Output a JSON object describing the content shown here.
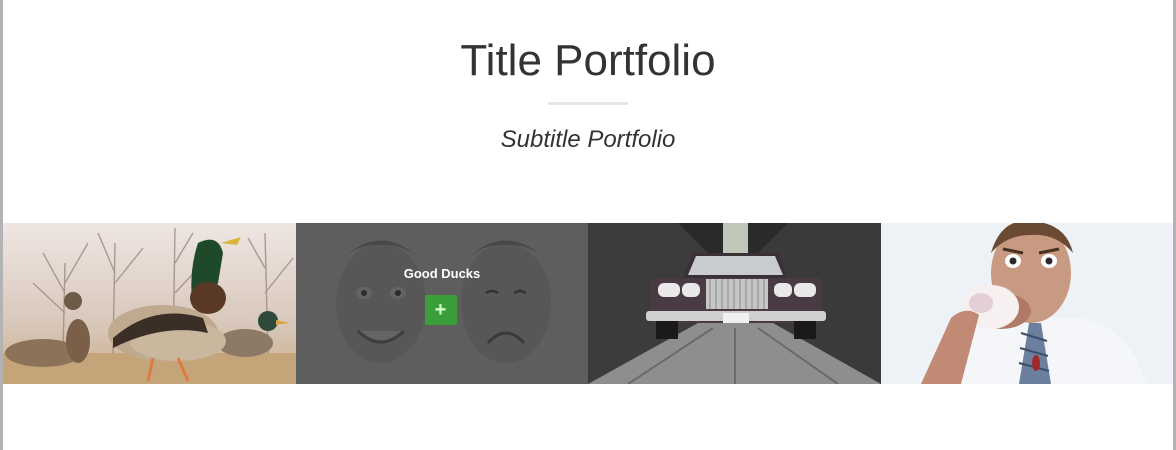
{
  "header": {
    "title": "Title Portfolio",
    "subtitle": "Subtitle Portfolio"
  },
  "gallery": {
    "items": [
      {
        "image": "ducks-photo",
        "caption": ""
      },
      {
        "image": "faces-photo",
        "caption": "Good Ducks",
        "action_icon": "plus-icon",
        "hovered": true
      },
      {
        "image": "vintage-car-photo",
        "caption": ""
      },
      {
        "image": "man-eating-donut-photo",
        "caption": ""
      }
    ]
  },
  "colors": {
    "title": "#333333",
    "rule": "#e6e6e6",
    "overlay": "#282828",
    "accent_button": "#3a9e3a",
    "frame": "#b3b3b3"
  }
}
